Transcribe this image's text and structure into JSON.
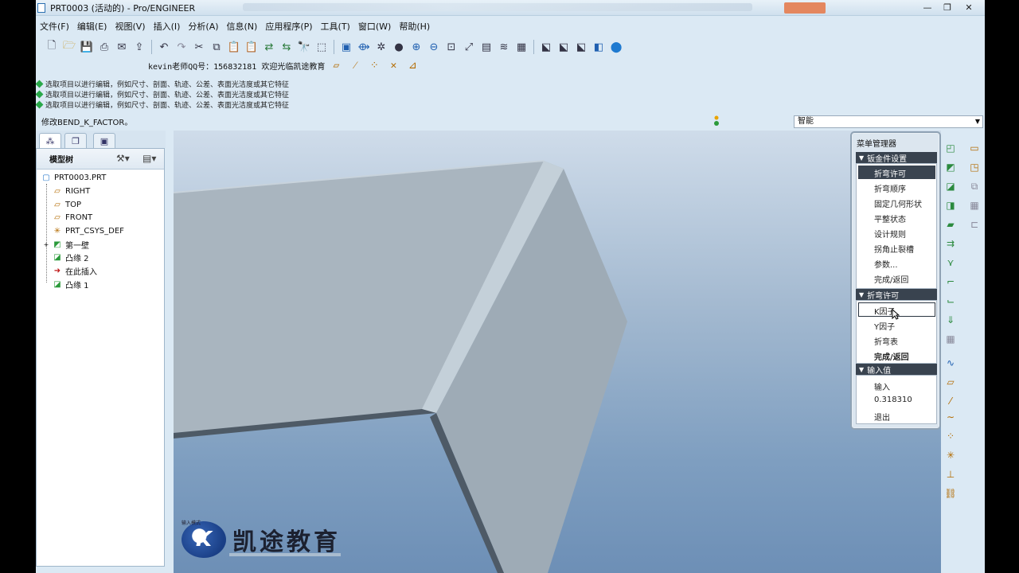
{
  "window": {
    "title": "PRT0003 (活动的) - Pro/ENGINEER",
    "min_glyph": "—",
    "max_glyph": "❐",
    "close_glyph": "✕"
  },
  "menubar": {
    "items": [
      "文件(F)",
      "编辑(E)",
      "视图(V)",
      "插入(I)",
      "分析(A)",
      "信息(N)",
      "应用程序(P)",
      "工具(T)",
      "窗口(W)",
      "帮助(H)"
    ]
  },
  "toolbar": {
    "banner_text": "kevin老师QQ号：156832181 欢迎光临凯途教育"
  },
  "messages": [
    "选取项目以进行编辑，例如尺寸、剖面、轨迹、公差、表面光洁度或其它特征",
    "选取项目以进行编辑，例如尺寸、剖面、轨迹、公差、表面光洁度或其它特征",
    "选取项目以进行编辑，例如尺寸、剖面、轨迹、公差、表面光洁度或其它特征"
  ],
  "prompt": "修改BEND_K_FACTOR。",
  "filter": {
    "value": "智能"
  },
  "model_tree": {
    "header": "模型树",
    "nodes": [
      {
        "label": "PRT0003.PRT",
        "icon": "part-icon"
      },
      {
        "label": "RIGHT",
        "icon": "datum-plane-icon"
      },
      {
        "label": "TOP",
        "icon": "datum-plane-icon"
      },
      {
        "label": "FRONT",
        "icon": "datum-plane-icon"
      },
      {
        "label": "PRT_CSYS_DEF",
        "icon": "csys-icon"
      },
      {
        "label": "第一壁",
        "icon": "sheetmetal-wall-icon"
      },
      {
        "label": "凸缘 2",
        "icon": "flange-icon"
      },
      {
        "label": "在此插入",
        "icon": "insert-here-arrow-icon"
      },
      {
        "label": "凸缘 1",
        "icon": "flange-icon"
      }
    ]
  },
  "menu_manager": {
    "title": "菜单管理器",
    "sections": [
      {
        "header": "钣金件设置",
        "items": [
          "折弯许可",
          "折弯顺序",
          "固定几何形状",
          "平整状态",
          "设计规则",
          "拐角止裂槽",
          "参数...",
          "完成/返回"
        ],
        "selected_index": 0
      },
      {
        "header": "折弯许可",
        "items": [
          "K因子",
          "Y因子",
          "折弯表",
          "完成/返回"
        ],
        "highlighted_index": 0
      },
      {
        "header": "输入值",
        "items": [
          "输入",
          "0.318310",
          "退出"
        ]
      }
    ]
  },
  "watermark": {
    "brand": "凯途教育",
    "small": "输入模式"
  },
  "colors": {
    "menu_section_bg": "#39434f",
    "viewport_top": "#cfdcea",
    "viewport_bottom": "#6d8fb6",
    "model_face": "#a7b4be"
  }
}
